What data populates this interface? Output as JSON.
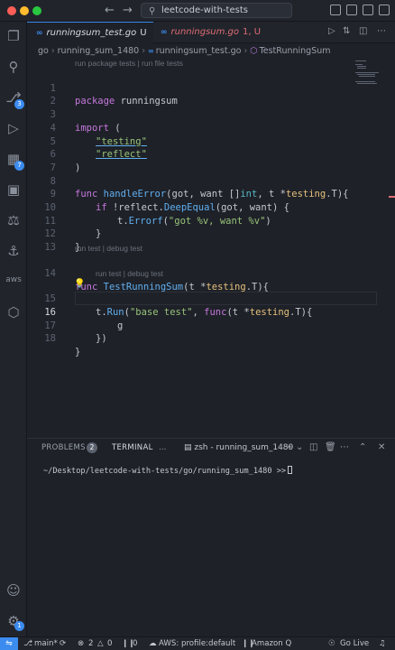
{
  "titlebar": {
    "search_text": "leetcode-with-tests",
    "back_icon": "arrow-left-icon",
    "forward_icon": "arrow-right-icon"
  },
  "activity": {
    "source_control_badge": "3",
    "extensions_badge": "7",
    "aws_label": "aws",
    "settings_badge": "1"
  },
  "tabs": [
    {
      "label": "runningsum_test.go",
      "status": "U"
    },
    {
      "label": "runningsum.go",
      "status": "1, U"
    }
  ],
  "breadcrumb": {
    "parts": [
      "go",
      "running_sum_1480",
      "runningsum_test.go",
      "TestRunningSum"
    ]
  },
  "editor": {
    "lens_package": "run package tests | run file tests",
    "lens_test": "run test | debug test",
    "lens_subtest": "run test | debug test",
    "line_numbers": [
      "1",
      "2",
      "3",
      "4",
      "5",
      "6",
      "7",
      "8",
      "9",
      "10",
      "11",
      "12",
      "13",
      "14",
      "15",
      "16",
      "17",
      "18"
    ],
    "lines": {
      "l1_kw": "package",
      "l1_name": " runningsum",
      "l3_kw": "import",
      "l3_rest": " (",
      "l4_str": "\"testing\"",
      "l5_str": "\"reflect\"",
      "l6": ")",
      "l8_kw": "func",
      "l8_fn": "handleError",
      "l8_a": "(got, want []",
      "l8_ty1": "int",
      "l8_b": ", t *",
      "l8_pkg": "testing",
      "l8_c": ".T){",
      "l9_kw": "if",
      "l9_a": " !reflect.",
      "l9_fn": "DeepEqual",
      "l9_b": "(got, want) {",
      "l10_a": "t.",
      "l10_fn": "Errorf",
      "l10_b": "(",
      "l10_str": "\"got %v, want %v\"",
      "l10_c": ")",
      "l11": "}",
      "l12": "}",
      "l14_kw": "func",
      "l14_fn": "TestRunningSum",
      "l14_a": "(t *",
      "l14_pkg": "testing",
      "l14_b": ".T){",
      "l15_a": "t.",
      "l15_fn": "Run",
      "l15_b": "(",
      "l15_str": "\"base test\"",
      "l15_c": ", ",
      "l15_kw": "func",
      "l15_d": "(t *",
      "l15_pkg": "testing",
      "l15_e": ".T){",
      "l16": "g",
      "l17": "})",
      "l18": "}"
    }
  },
  "panel": {
    "problems_label": "PROBLEMS",
    "problems_count": "2",
    "terminal_label": "TERMINAL",
    "more_label": "…",
    "terminal_name": "zsh - running_sum_1480",
    "prompt": "~/Desktop/leetcode-with-tests/go/running_sum_1480 >>"
  },
  "statusbar": {
    "branch": "main*",
    "errors": "2",
    "warnings": "0",
    "ports": "0",
    "aws_profile": "AWS: profile:default",
    "amazon_q": "Amazon Q",
    "go_live": "Go Live"
  },
  "colors": {
    "accent": "#3c8cf0",
    "keyword": "#c678dd",
    "function": "#61afef",
    "string": "#98c379",
    "modified_tab": "#e06c75"
  }
}
